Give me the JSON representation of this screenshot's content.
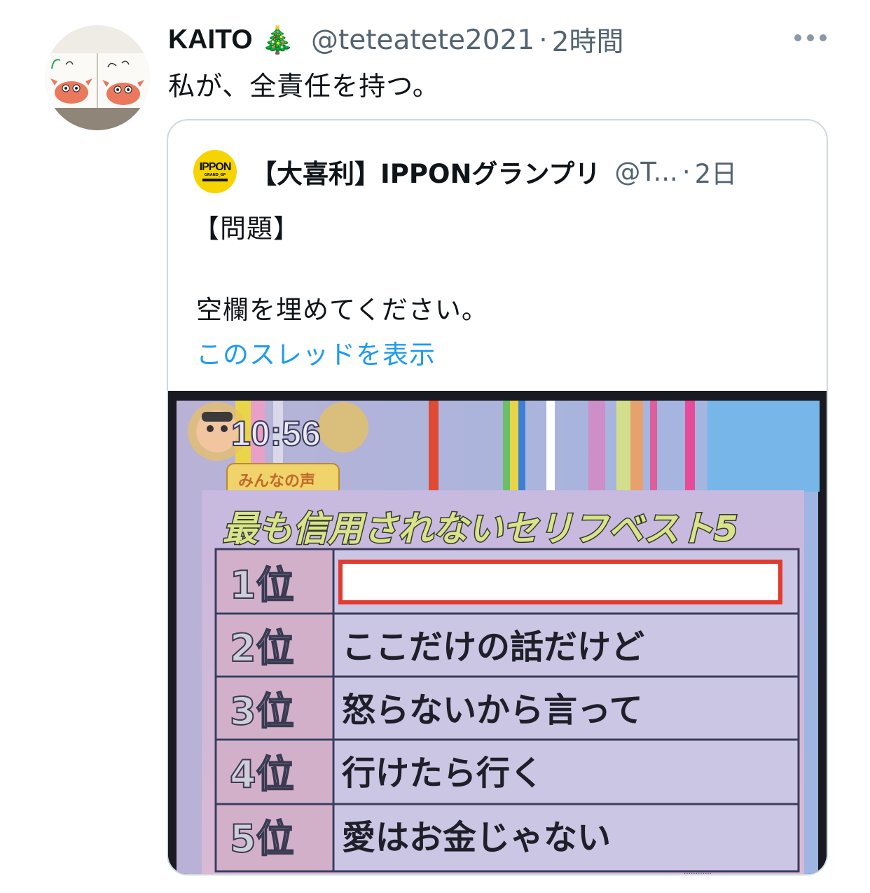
{
  "tweet": {
    "display_name": "KAITO",
    "name_emoji": "🎄",
    "handle": "@teteatete2021",
    "separator": "·",
    "time": "2時間",
    "text": "私が、全責任を持つ。",
    "avatar_icon": "crab-drawing-avatar-icon",
    "more_icon": "more-dots-icon"
  },
  "quoted": {
    "display_name": "【大喜利】IPPONグランプリ",
    "handle": "@T...",
    "separator": "·",
    "time": "2日",
    "avatar_text": "IPPON",
    "avatar_subtext": "GRAND_GP",
    "avatar_color": "#f5d400",
    "line1": "【問題】",
    "line2": "空欄を埋めてください。",
    "show_thread": "このスレッドを表示"
  },
  "media": {
    "clock": "10:56",
    "corner_badge": "みんなの声",
    "title": "最も信用されないセリフベスト5",
    "footer_caption": "…………",
    "ranks": [
      {
        "rank": "1位",
        "text": ""
      },
      {
        "rank": "2位",
        "text": "ここだけの話だけど"
      },
      {
        "rank": "3位",
        "text": "怒らないから言って"
      },
      {
        "rank": "4位",
        "text": "行けたら行く"
      },
      {
        "rank": "5位",
        "text": "愛はお金じゃない"
      }
    ],
    "colors": {
      "highlight_border": "#e23a2f",
      "title_text": "#dbe38a",
      "rank_text": "#cfcfda"
    }
  }
}
